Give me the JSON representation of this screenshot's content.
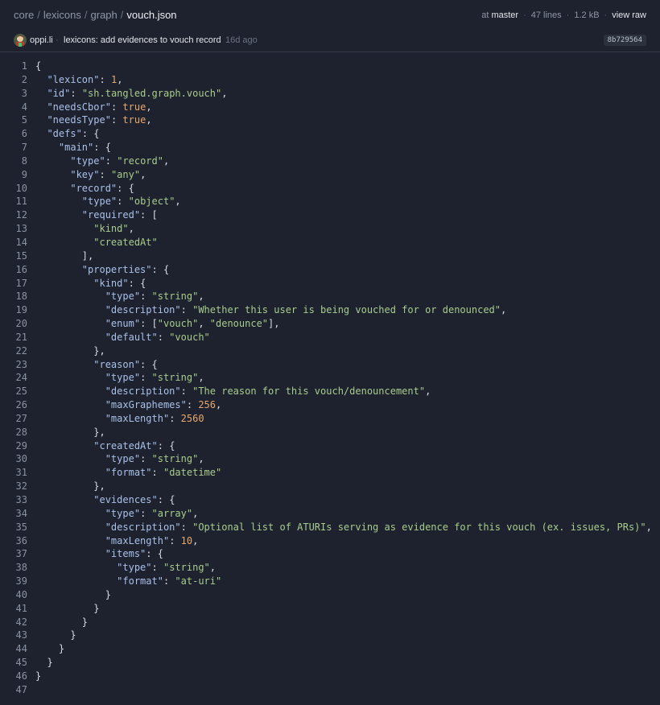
{
  "breadcrumb": {
    "segments": [
      "core",
      "lexicons",
      "graph"
    ],
    "separator": "/",
    "current": "vouch.json"
  },
  "file_info": {
    "branch_prefix": "at",
    "branch": "master",
    "lines": "47 lines",
    "size": "1.2 kB",
    "view_raw": "view raw",
    "dot": "·"
  },
  "commit": {
    "author": "oppi.li",
    "dot": "·",
    "message": "lexicons: add evidences to vouch record",
    "age": "16d ago",
    "hash": "8b729564"
  },
  "colors": {
    "background": "#1e222e",
    "key": "#a9c0e9",
    "string": "#a8cc8c",
    "number": "#e6a86e",
    "line_number": "#8a92a3"
  },
  "code_lines": [
    "{",
    "  \"lexicon\": 1,",
    "  \"id\": \"sh.tangled.graph.vouch\",",
    "  \"needsCbor\": true,",
    "  \"needsType\": true,",
    "  \"defs\": {",
    "    \"main\": {",
    "      \"type\": \"record\",",
    "      \"key\": \"any\",",
    "      \"record\": {",
    "        \"type\": \"object\",",
    "        \"required\": [",
    "          \"kind\",",
    "          \"createdAt\"",
    "        ],",
    "        \"properties\": {",
    "          \"kind\": {",
    "            \"type\": \"string\",",
    "            \"description\": \"Whether this user is being vouched for or denounced\",",
    "            \"enum\": [\"vouch\", \"denounce\"],",
    "            \"default\": \"vouch\"",
    "          },",
    "          \"reason\": {",
    "            \"type\": \"string\",",
    "            \"description\": \"The reason for this vouch/denouncement\",",
    "            \"maxGraphemes\": 256,",
    "            \"maxLength\": 2560",
    "          },",
    "          \"createdAt\": {",
    "            \"type\": \"string\",",
    "            \"format\": \"datetime\"",
    "          },",
    "          \"evidences\": {",
    "            \"type\": \"array\",",
    "            \"description\": \"Optional list of ATURIs serving as evidence for this vouch (ex. issues, PRs)\",",
    "            \"maxLength\": 10,",
    "            \"items\": {",
    "              \"type\": \"string\",",
    "              \"format\": \"at-uri\"",
    "            }",
    "          }",
    "        }",
    "      }",
    "    }",
    "  }",
    "}",
    ""
  ]
}
